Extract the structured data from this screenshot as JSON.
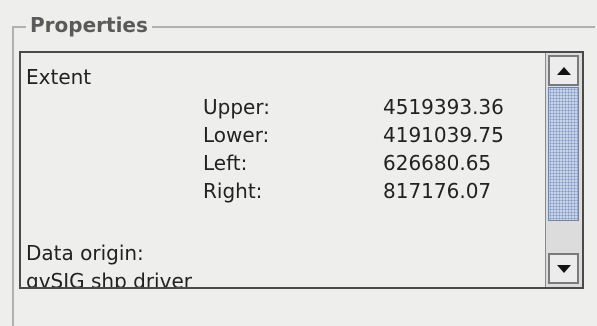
{
  "properties_panel": {
    "title": "Properties",
    "extent_heading": "Extent",
    "extent_rows": [
      {
        "label": "Upper:",
        "value": "4519393.36"
      },
      {
        "label": "Lower:",
        "value": "4191039.75"
      },
      {
        "label": "Left:",
        "value": "626680.65"
      },
      {
        "label": "Right:",
        "value": "817176.07"
      }
    ],
    "data_origin_label": "Data origin:",
    "data_origin_value": "gvSIG shp driver"
  },
  "scrollbar": {
    "up_icon": "arrow-up-icon",
    "down_icon": "arrow-down-icon"
  }
}
